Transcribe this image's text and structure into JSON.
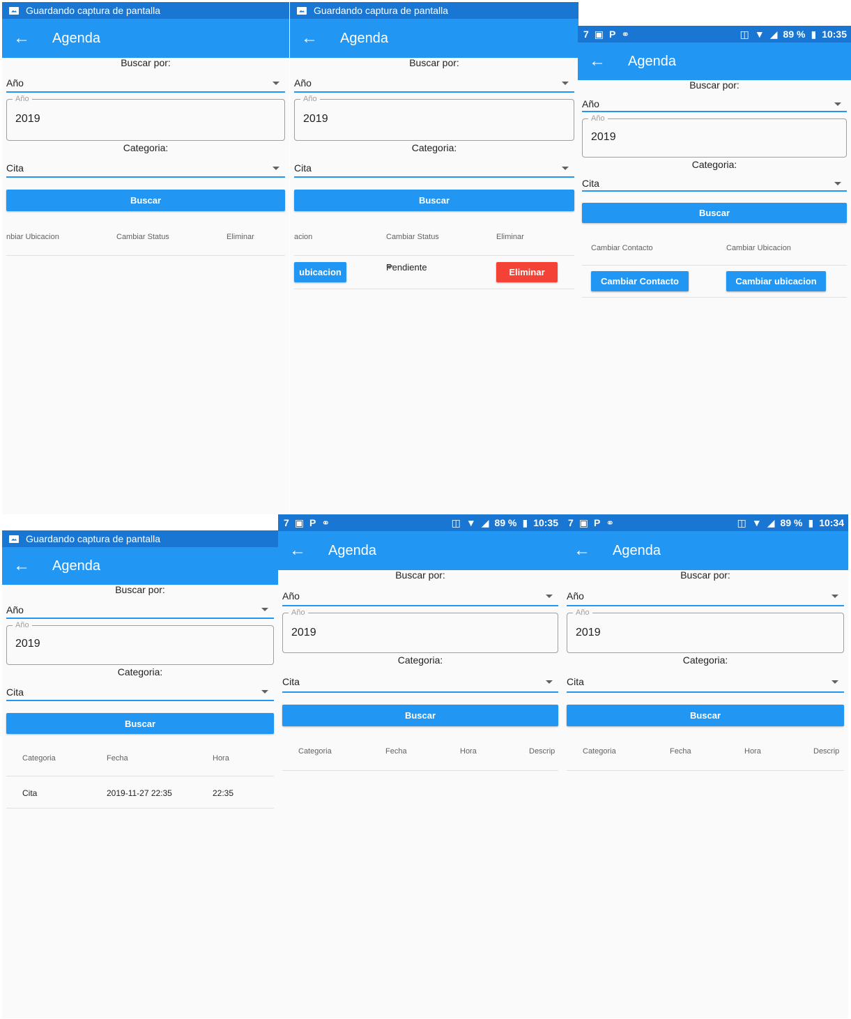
{
  "notification_text": "Guardando captura de pantalla",
  "status_bar": {
    "battery": "89 %",
    "time_a": "10:35",
    "time_b": "10:34",
    "icons": [
      "seven-icon",
      "image-icon",
      "p-icon",
      "messenger-icon",
      "vibrate-icon",
      "wifi-icon",
      "signal-icon",
      "battery-icon"
    ]
  },
  "appbar": {
    "title": "Agenda"
  },
  "form": {
    "buscar_por_label": "Buscar por:",
    "buscar_por_value": "Año",
    "year_legend": "Año",
    "year_value": "2019",
    "categoria_label": "Categoria:",
    "categoria_value": "Cita",
    "buscar_button": "Buscar"
  },
  "table_actions": {
    "col_ubicacion_cut": "nbiar Ubicacion",
    "col_ubicacion_cut2": "acion",
    "col_status": "Cambiar Status",
    "col_eliminar": "Eliminar",
    "row_ubicacion_btn": "ubicacion",
    "row_status_value": "Pendiente",
    "row_eliminar_btn": "Eliminar"
  },
  "table_contact": {
    "col_contacto": "Cambiar Contacto",
    "col_ubicacion": "Cambiar Ubicacion",
    "btn_contacto": "Cambiar Contacto",
    "btn_ubicacion": "Cambiar ubicacion"
  },
  "table_results": {
    "col_categoria": "Categoria",
    "col_fecha": "Fecha",
    "col_hora": "Hora",
    "col_descripcion_cut": "Descrip",
    "row": {
      "categoria": "Cita",
      "fecha": "2019-11-27 22:35",
      "hora": "22:35"
    }
  },
  "colors": {
    "primary": "#2196f3",
    "status": "#1976d2",
    "danger": "#f44336"
  }
}
